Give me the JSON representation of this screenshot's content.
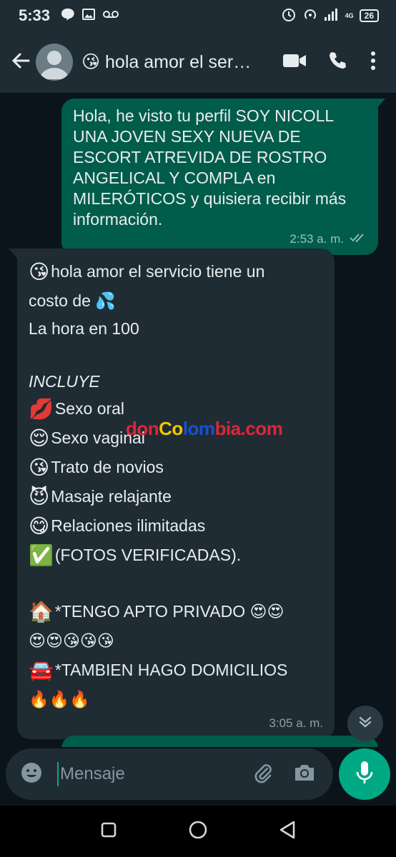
{
  "status_bar": {
    "time": "5:33",
    "network_type": "4G",
    "battery": "26"
  },
  "header": {
    "back_icon": "arrow-left-icon",
    "title": "😘 hola amor el servicio tiene un costo de 💦",
    "video_call_icon": "video-camera-icon",
    "voice_call_icon": "phone-icon",
    "menu_icon": "more-vert-icon"
  },
  "messages": [
    {
      "direction": "outgoing",
      "text": "Hola, he visto tu perfil SOY NICOLL UNA JOVEN SEXY NUEVA DE ESCORT ATREVIDA DE ROSTRO ANGELICAL Y COMPLA en MILERÓTICOS y quisiera recibir más información.",
      "time": "2:53 a. m.",
      "status": "read"
    },
    {
      "direction": "incoming",
      "lines": [
        {
          "emoji": "😘",
          "text": " hola amor el servicio tiene un"
        },
        {
          "emoji": "",
          "text": "costo de 💦"
        },
        {
          "emoji": "",
          "text": "La hora en 100"
        },
        {
          "emoji": "",
          "text": ""
        },
        {
          "emoji": "",
          "text": "INCLUYE"
        },
        {
          "emoji": "💋",
          "text": "Sexo oral"
        },
        {
          "emoji": "😌",
          "text": "Sexo vaginal"
        },
        {
          "emoji": "😘",
          "text": "Trato de novios"
        },
        {
          "emoji": "😈",
          "text": "Masaje relajante"
        },
        {
          "emoji": "😋",
          "text": "Relaciones ilimitadas"
        },
        {
          "emoji": "✅",
          "text": "(FOTOS VERIFICADAS)."
        },
        {
          "emoji": "",
          "text": ""
        },
        {
          "emoji": "🏠",
          "text": " *TENGO APTO PRIVADO 😍😍"
        },
        {
          "emoji": "",
          "text": "😍😍😘😘😘"
        },
        {
          "emoji": "🚘",
          "text": "*TAMBIEN HAGO DOMICILIOS"
        },
        {
          "emoji": "",
          "text": "🔥🔥🔥"
        }
      ],
      "time": "3:05 a. m."
    }
  ],
  "watermark": {
    "part1": "don",
    "part2": "Co",
    "part3": "lom",
    "part4": "bia.com"
  },
  "input": {
    "placeholder": "Mensaje",
    "value": "",
    "emoji_icon": "emoji-smile-icon",
    "attach_icon": "paperclip-icon",
    "camera_icon": "camera-icon",
    "mic_icon": "microphone-icon"
  },
  "colors": {
    "background": "#0b141a",
    "bar": "#1f2c33",
    "outgoing_bubble": "#005c4b",
    "incoming_bubble": "#1f2c33",
    "accent": "#00a884",
    "read_tick": "#9cc2b9"
  }
}
